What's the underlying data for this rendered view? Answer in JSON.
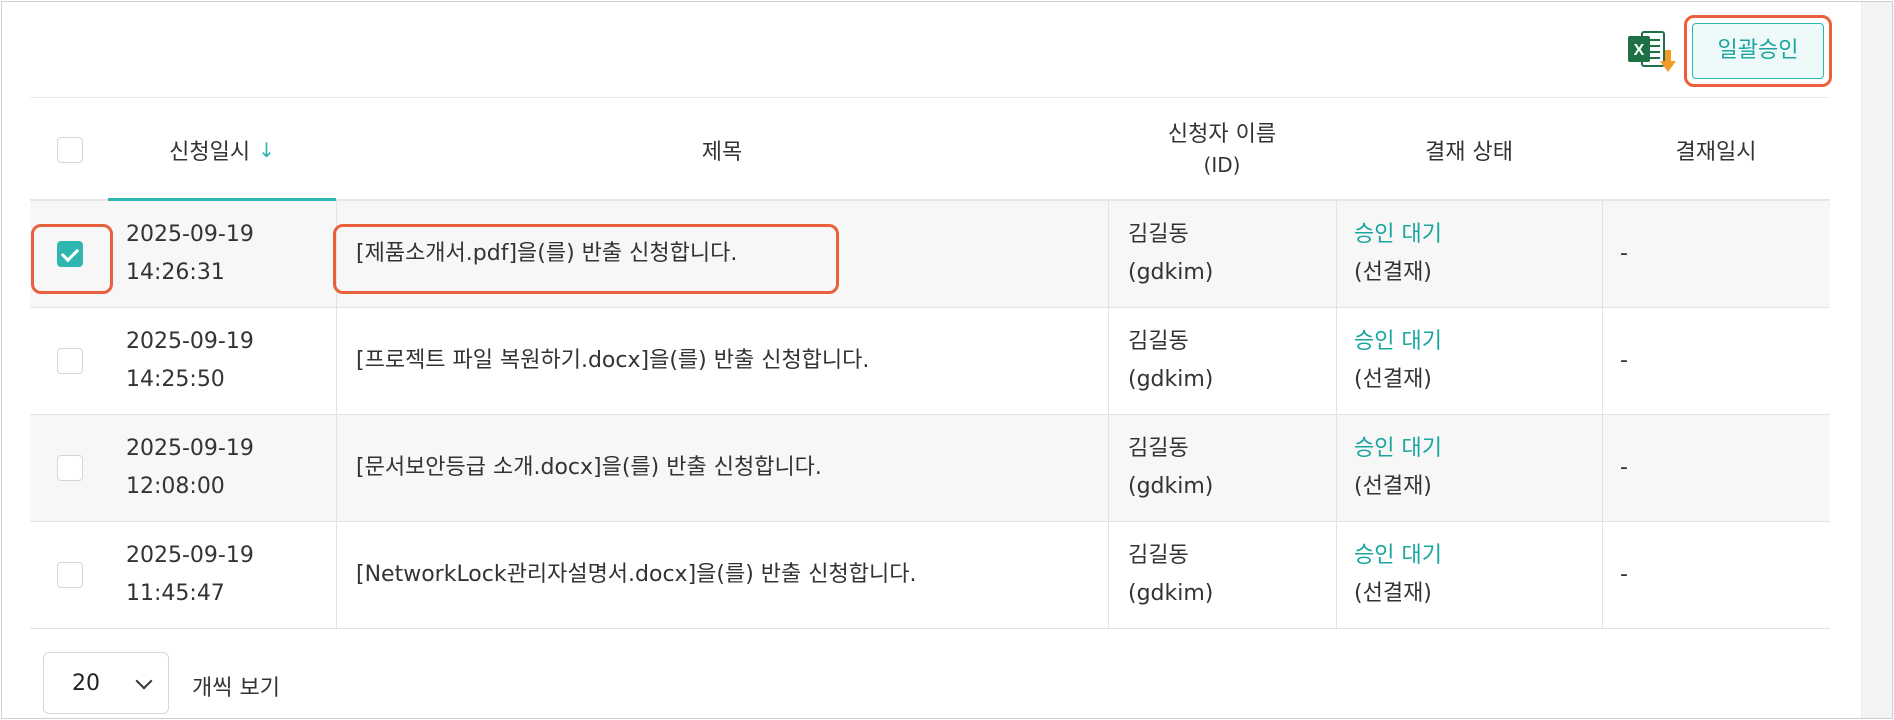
{
  "toolbar": {
    "excel_icon": "excel-download-icon",
    "bulk_approve_label": "일괄승인"
  },
  "table": {
    "headers": {
      "date": "신청일시",
      "sort_icon": "arrow-down-icon",
      "title": "제목",
      "applicant": "신청자 이름",
      "applicant_sub": "(ID)",
      "status": "결재 상태",
      "approved_at": "결재일시"
    },
    "rows": [
      {
        "checked": true,
        "date": "2025-09-19",
        "time": "14:26:31",
        "title": "[제품소개서.pdf]을(를) 반출 신청합니다.",
        "name": "김길동",
        "id": "(gdkim)",
        "status": "승인 대기",
        "status_sub": "(선결재)",
        "approved_at": "-"
      },
      {
        "checked": false,
        "date": "2025-09-19",
        "time": "14:25:50",
        "title": "[프로젝트 파일 복원하기.docx]을(를) 반출 신청합니다.",
        "name": "김길동",
        "id": "(gdkim)",
        "status": "승인 대기",
        "status_sub": "(선결재)",
        "approved_at": "-"
      },
      {
        "checked": false,
        "date": "2025-09-19",
        "time": "12:08:00",
        "title": "[문서보안등급 소개.docx]을(를) 반출 신청합니다.",
        "name": "김길동",
        "id": "(gdkim)",
        "status": "승인 대기",
        "status_sub": "(선결재)",
        "approved_at": "-"
      },
      {
        "checked": false,
        "date": "2025-09-19",
        "time": "11:45:47",
        "title": "[NetworkLock관리자설명서.docx]을(를) 반출 신청합니다.",
        "name": "김길동",
        "id": "(gdkim)",
        "status": "승인 대기",
        "status_sub": "(선결재)",
        "approved_at": "-"
      }
    ]
  },
  "pagination": {
    "page_size": "20",
    "page_size_label": "개씩 보기"
  },
  "colors": {
    "accent": "#2fb6b0",
    "highlight": "#e8603c",
    "excel_green": "#1e7145",
    "excel_arrow": "#f29b2b"
  }
}
